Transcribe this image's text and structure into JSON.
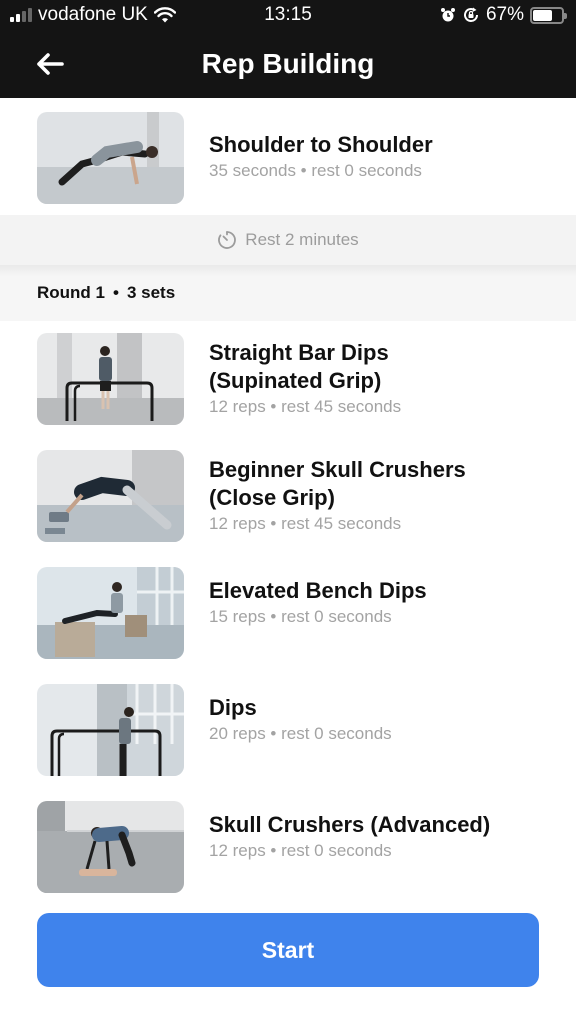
{
  "status_bar": {
    "carrier": "vodafone UK",
    "time": "13:15",
    "battery_percent": "67%",
    "battery_level": 0.67,
    "icons": [
      "signal-icon",
      "wifi-icon",
      "alarm-icon",
      "rotation-lock-icon",
      "battery-icon"
    ]
  },
  "nav": {
    "back_icon": "arrow-left-icon",
    "title": "Rep Building"
  },
  "top_exercise": {
    "name": "Shoulder to Shoulder",
    "detail": "35 seconds • rest 0 seconds"
  },
  "rest": {
    "icon": "timer-icon",
    "label": "Rest 2 minutes"
  },
  "round": {
    "label": "Round 1",
    "separator": "•",
    "sets": "3 sets"
  },
  "exercises": [
    {
      "name_line1": "Straight Bar Dips",
      "name_line2": "(Supinated Grip)",
      "detail": "12 reps • rest 45 seconds"
    },
    {
      "name_line1": "Beginner Skull Crushers",
      "name_line2": "(Close Grip)",
      "detail": "12 reps • rest 45 seconds"
    },
    {
      "name_line1": "Elevated Bench Dips",
      "name_line2": "",
      "detail": "15 reps • rest 0 seconds"
    },
    {
      "name_line1": "Dips",
      "name_line2": "",
      "detail": "20 reps • rest 0 seconds"
    },
    {
      "name_line1": "Skull Crushers (Advanced)",
      "name_line2": "",
      "detail": "12 reps • rest 0 seconds"
    }
  ],
  "start_button": {
    "label": "Start",
    "color": "#3f83ec"
  }
}
